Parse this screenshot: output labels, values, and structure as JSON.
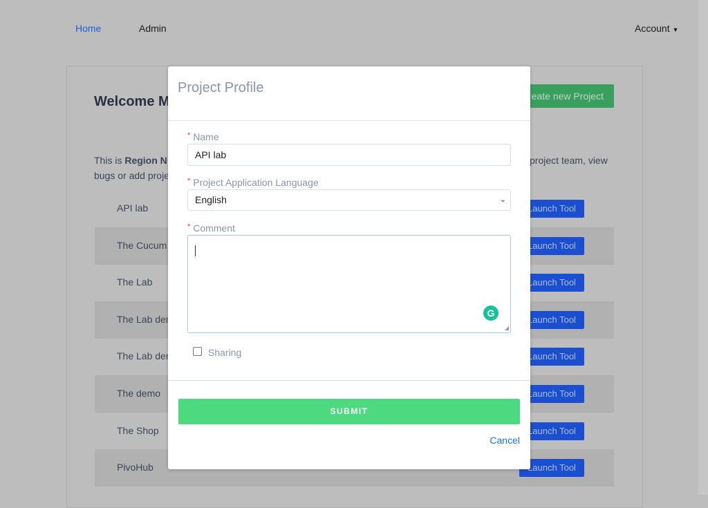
{
  "nav": {
    "home": "Home",
    "admin": "Admin",
    "account": "Account"
  },
  "background": {
    "welcome_partial": "Welcome M",
    "create_button_partial": "eate new Project",
    "intro_prefix": "This is ",
    "intro_bold_partial": "Region N",
    "intro_right_partial": "project team, view",
    "intro_line2_partial": "bugs or add proje",
    "projects": [
      {
        "name": "API lab",
        "action": "Launch Tool"
      },
      {
        "name": "The Cucum",
        "action": "Launch Tool"
      },
      {
        "name": "The Lab",
        "action": "Launch Tool"
      },
      {
        "name": "The Lab der",
        "action": "Launch Tool"
      },
      {
        "name": "The Lab der",
        "action": "Launch Tool"
      },
      {
        "name": "The demo",
        "action": "Launch Tool"
      },
      {
        "name": "The Shop",
        "action": "Launch Tool"
      },
      {
        "name": "PivoHub",
        "action": "Launch Tool"
      }
    ]
  },
  "modal": {
    "title": "Project Profile",
    "name_label": "Name",
    "name_value": "API lab",
    "language_label": "Project Application Language",
    "language_value": "English",
    "comment_label": "Comment",
    "comment_value": "",
    "required_mark": "*",
    "sharing_label": "Sharing",
    "sharing_checked": false,
    "submit": "SUBMIT",
    "cancel": "Cancel"
  },
  "colors": {
    "submit": "#4cd97f",
    "cancel": "#1a73e8",
    "grammarly": "#15c39a",
    "launch": "#1c4fcf"
  }
}
